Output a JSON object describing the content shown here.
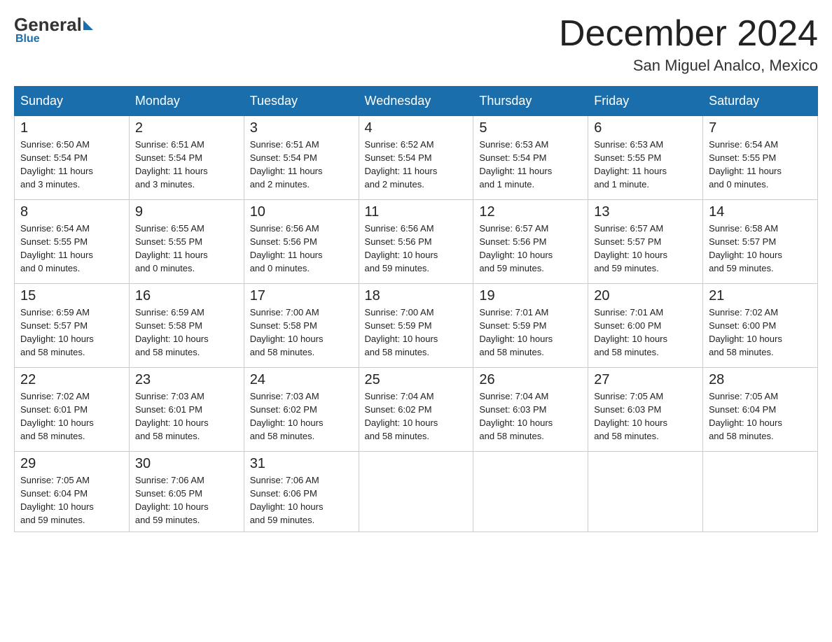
{
  "logo": {
    "general": "General",
    "blue": "Blue"
  },
  "title": "December 2024",
  "location": "San Miguel Analco, Mexico",
  "days_header": [
    "Sunday",
    "Monday",
    "Tuesday",
    "Wednesday",
    "Thursday",
    "Friday",
    "Saturday"
  ],
  "weeks": [
    [
      {
        "num": "1",
        "info": "Sunrise: 6:50 AM\nSunset: 5:54 PM\nDaylight: 11 hours\nand 3 minutes."
      },
      {
        "num": "2",
        "info": "Sunrise: 6:51 AM\nSunset: 5:54 PM\nDaylight: 11 hours\nand 3 minutes."
      },
      {
        "num": "3",
        "info": "Sunrise: 6:51 AM\nSunset: 5:54 PM\nDaylight: 11 hours\nand 2 minutes."
      },
      {
        "num": "4",
        "info": "Sunrise: 6:52 AM\nSunset: 5:54 PM\nDaylight: 11 hours\nand 2 minutes."
      },
      {
        "num": "5",
        "info": "Sunrise: 6:53 AM\nSunset: 5:54 PM\nDaylight: 11 hours\nand 1 minute."
      },
      {
        "num": "6",
        "info": "Sunrise: 6:53 AM\nSunset: 5:55 PM\nDaylight: 11 hours\nand 1 minute."
      },
      {
        "num": "7",
        "info": "Sunrise: 6:54 AM\nSunset: 5:55 PM\nDaylight: 11 hours\nand 0 minutes."
      }
    ],
    [
      {
        "num": "8",
        "info": "Sunrise: 6:54 AM\nSunset: 5:55 PM\nDaylight: 11 hours\nand 0 minutes."
      },
      {
        "num": "9",
        "info": "Sunrise: 6:55 AM\nSunset: 5:55 PM\nDaylight: 11 hours\nand 0 minutes."
      },
      {
        "num": "10",
        "info": "Sunrise: 6:56 AM\nSunset: 5:56 PM\nDaylight: 11 hours\nand 0 minutes."
      },
      {
        "num": "11",
        "info": "Sunrise: 6:56 AM\nSunset: 5:56 PM\nDaylight: 10 hours\nand 59 minutes."
      },
      {
        "num": "12",
        "info": "Sunrise: 6:57 AM\nSunset: 5:56 PM\nDaylight: 10 hours\nand 59 minutes."
      },
      {
        "num": "13",
        "info": "Sunrise: 6:57 AM\nSunset: 5:57 PM\nDaylight: 10 hours\nand 59 minutes."
      },
      {
        "num": "14",
        "info": "Sunrise: 6:58 AM\nSunset: 5:57 PM\nDaylight: 10 hours\nand 59 minutes."
      }
    ],
    [
      {
        "num": "15",
        "info": "Sunrise: 6:59 AM\nSunset: 5:57 PM\nDaylight: 10 hours\nand 58 minutes."
      },
      {
        "num": "16",
        "info": "Sunrise: 6:59 AM\nSunset: 5:58 PM\nDaylight: 10 hours\nand 58 minutes."
      },
      {
        "num": "17",
        "info": "Sunrise: 7:00 AM\nSunset: 5:58 PM\nDaylight: 10 hours\nand 58 minutes."
      },
      {
        "num": "18",
        "info": "Sunrise: 7:00 AM\nSunset: 5:59 PM\nDaylight: 10 hours\nand 58 minutes."
      },
      {
        "num": "19",
        "info": "Sunrise: 7:01 AM\nSunset: 5:59 PM\nDaylight: 10 hours\nand 58 minutes."
      },
      {
        "num": "20",
        "info": "Sunrise: 7:01 AM\nSunset: 6:00 PM\nDaylight: 10 hours\nand 58 minutes."
      },
      {
        "num": "21",
        "info": "Sunrise: 7:02 AM\nSunset: 6:00 PM\nDaylight: 10 hours\nand 58 minutes."
      }
    ],
    [
      {
        "num": "22",
        "info": "Sunrise: 7:02 AM\nSunset: 6:01 PM\nDaylight: 10 hours\nand 58 minutes."
      },
      {
        "num": "23",
        "info": "Sunrise: 7:03 AM\nSunset: 6:01 PM\nDaylight: 10 hours\nand 58 minutes."
      },
      {
        "num": "24",
        "info": "Sunrise: 7:03 AM\nSunset: 6:02 PM\nDaylight: 10 hours\nand 58 minutes."
      },
      {
        "num": "25",
        "info": "Sunrise: 7:04 AM\nSunset: 6:02 PM\nDaylight: 10 hours\nand 58 minutes."
      },
      {
        "num": "26",
        "info": "Sunrise: 7:04 AM\nSunset: 6:03 PM\nDaylight: 10 hours\nand 58 minutes."
      },
      {
        "num": "27",
        "info": "Sunrise: 7:05 AM\nSunset: 6:03 PM\nDaylight: 10 hours\nand 58 minutes."
      },
      {
        "num": "28",
        "info": "Sunrise: 7:05 AM\nSunset: 6:04 PM\nDaylight: 10 hours\nand 58 minutes."
      }
    ],
    [
      {
        "num": "29",
        "info": "Sunrise: 7:05 AM\nSunset: 6:04 PM\nDaylight: 10 hours\nand 59 minutes."
      },
      {
        "num": "30",
        "info": "Sunrise: 7:06 AM\nSunset: 6:05 PM\nDaylight: 10 hours\nand 59 minutes."
      },
      {
        "num": "31",
        "info": "Sunrise: 7:06 AM\nSunset: 6:06 PM\nDaylight: 10 hours\nand 59 minutes."
      },
      {
        "num": "",
        "info": ""
      },
      {
        "num": "",
        "info": ""
      },
      {
        "num": "",
        "info": ""
      },
      {
        "num": "",
        "info": ""
      }
    ]
  ]
}
